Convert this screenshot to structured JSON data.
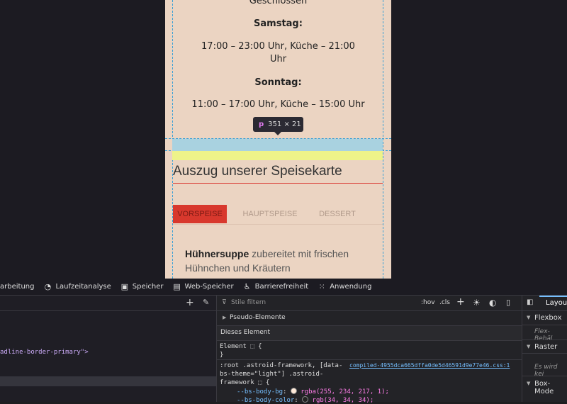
{
  "page": {
    "closed_text": "Geschlossen",
    "saturday_label": "Samstag:",
    "saturday_hours_line1": "17:00 – 23:00 Uhr, Küche – 21:00",
    "saturday_hours_line2": "Uhr",
    "sunday_label": "Sonntag:",
    "sunday_hours": "11:00 – 17:00 Uhr, Küche – 15:00 Uhr",
    "menu_heading": "Auszug unserer Speisekarte",
    "tabs": [
      "VORSPEISE",
      "HAUPTSPEISE",
      "DESSERT"
    ],
    "dish_name": "Hühnersuppe",
    "dish_desc": " zubereitet mit frischen Hühnchen und Kräutern"
  },
  "inspector_tooltip": {
    "tag": "p",
    "size": "351 × 21"
  },
  "devtools": {
    "tabs": [
      "arbeitung",
      "Laufzeitanalyse",
      "Speicher",
      "Web-Speicher",
      "Barrierefreiheit",
      "Anwendung"
    ],
    "html_snippet": "adline-border-primary\">",
    "filter_placeholder": "Stile filtern",
    "hov": ":hov",
    "cls": ".cls",
    "pseudo": "Pseudo-Elemente",
    "this_element": "Dieses Element",
    "element_rule": "Element ⬚ {",
    "close_brace": "}",
    "selector_line1": ":root .astroid-framework, [data-",
    "selector_line2": "bs-theme=\"light\"] .astroid-",
    "selector_line3": "framework ⬚ {",
    "source_file": "compiled-4955dca665dffa0de5d46591d9e77e46.css:1",
    "prop1_name": "--bs-body-bg",
    "prop1_value": "rgba(255, 234, 217, 1);",
    "prop2_name": "--bs-body-color",
    "prop2_value": "rgb(34, 34, 34);",
    "layout_tab": "Layout",
    "flexbox": "Flexbox",
    "flex_note": "Flex-Behäl",
    "raster": "Raster",
    "raster_note": "Es wird kei",
    "boxmodel": "Box-Mode"
  },
  "colors": {
    "accent": "#d8382d",
    "page_bg": "#ebd4c2",
    "swatch1": "#ffead9",
    "swatch2": "#222222"
  }
}
